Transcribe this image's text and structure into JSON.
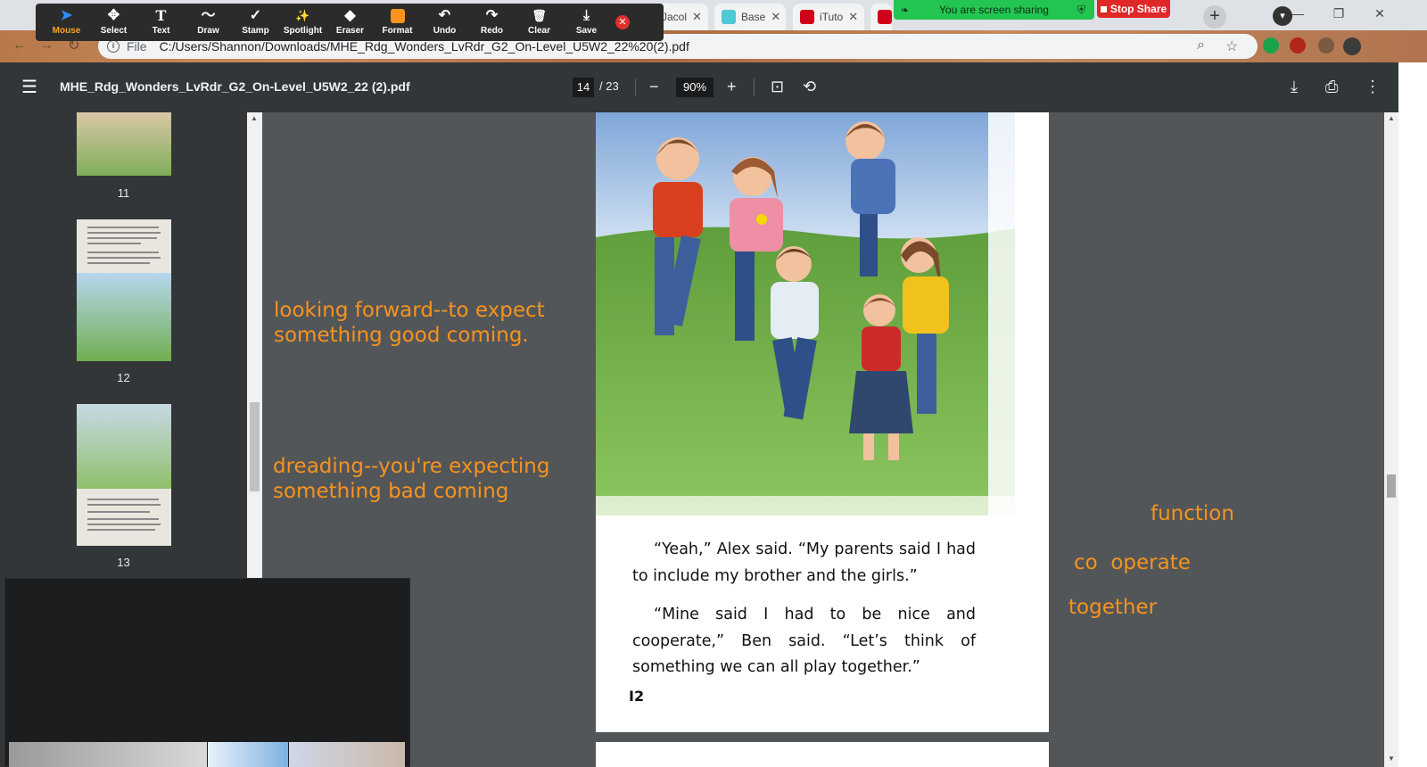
{
  "browser": {
    "tabs": [
      {
        "label": "Jacol",
        "color": "#8a8a8a"
      },
      {
        "label": "Base",
        "color": "#4ec9d6"
      },
      {
        "label": "iTuto",
        "color": "#d0021b"
      },
      {
        "label": "",
        "color": "#d0021b"
      }
    ],
    "address": {
      "scheme_label": "File",
      "url": "C:/Users/Shannon/Downloads/MHE_Rdg_Wonders_LvRdr_G2_On-Level_U5W2_22%20(2).pdf"
    },
    "window_controls": [
      "—",
      "❐",
      "✕"
    ]
  },
  "annotation_toolbar": {
    "tools": [
      {
        "label": "Mouse",
        "icon": "cursor-icon",
        "glyph": "➤",
        "active": true
      },
      {
        "label": "Select",
        "icon": "move-icon",
        "glyph": "✥",
        "active": false
      },
      {
        "label": "Text",
        "icon": "text-icon",
        "glyph": "T",
        "active": false
      },
      {
        "label": "Draw",
        "icon": "draw-icon",
        "glyph": "〜",
        "active": false
      },
      {
        "label": "Stamp",
        "icon": "stamp-icon",
        "glyph": "✓",
        "active": false
      },
      {
        "label": "Spotlight",
        "icon": "spotlight-icon",
        "glyph": "✨",
        "active": false
      },
      {
        "label": "Eraser",
        "icon": "eraser-icon",
        "glyph": "◆",
        "active": false
      },
      {
        "label": "Format",
        "icon": "format-icon",
        "glyph": "",
        "active": false
      },
      {
        "label": "Undo",
        "icon": "undo-icon",
        "glyph": "↶",
        "active": false
      },
      {
        "label": "Redo",
        "icon": "redo-icon",
        "glyph": "↷",
        "active": false
      },
      {
        "label": "Clear",
        "icon": "trash-icon",
        "glyph": "🗑",
        "active": false
      },
      {
        "label": "Save",
        "icon": "save-icon",
        "glyph": "⤓",
        "active": false
      }
    ],
    "format_color": "#f7931e"
  },
  "screen_share": {
    "banner_text": "You are screen sharing",
    "stop_label": "Stop Share"
  },
  "pdf_viewer": {
    "title": "MHE_Rdg_Wonders_LvRdr_G2_On-Level_U5W2_22 (2).pdf",
    "current_page": "14",
    "total_pages": "/ 23",
    "zoom": "90%"
  },
  "sidebar": {
    "thumbnails": [
      {
        "label": "11"
      },
      {
        "label": "12"
      },
      {
        "label": "13"
      }
    ]
  },
  "page": {
    "paragraphs": [
      "“Yeah,” Alex said. “My parents said I had to include my brother and the girls.”",
      "“Mine said I had to be nice and cooperate,” Ben said. “Let’s think of something we can all play together.”"
    ],
    "page_number": "I2"
  },
  "annotations": {
    "note1_line1": "looking forward--to expect",
    "note1_line2": "something good coming.",
    "note2_line1": "dreading--you're expecting",
    "note2_line2": "something bad coming",
    "note3": "function",
    "note4": "co  operate",
    "note5": "together",
    "color": "#f7931e"
  }
}
